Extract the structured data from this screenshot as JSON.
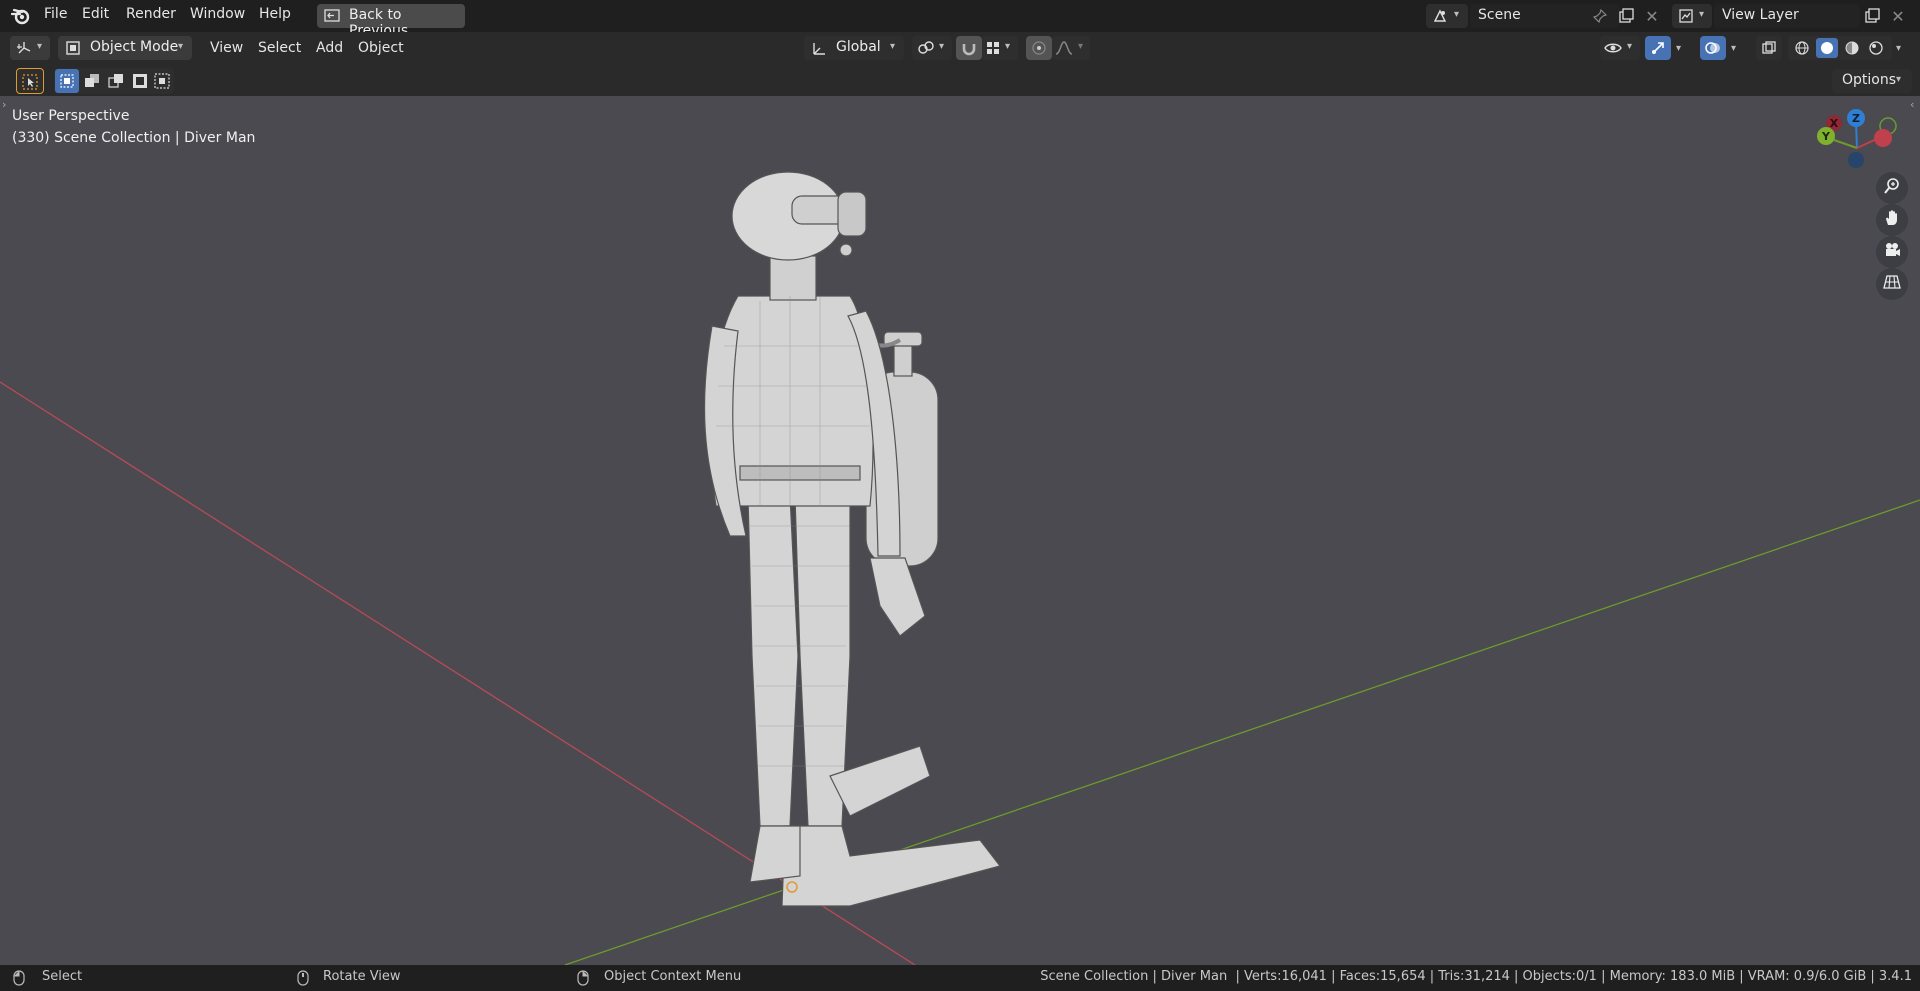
{
  "topbar": {
    "menus": [
      "File",
      "Edit",
      "Render",
      "Window",
      "Help"
    ],
    "back_button": "Back to Previous",
    "scene_name": "Scene",
    "view_layer_name": "View Layer"
  },
  "header": {
    "mode": "Object Mode",
    "menus": [
      "View",
      "Select",
      "Add",
      "Object"
    ],
    "transform_orientation": "Global"
  },
  "toolbar": {
    "options_label": "Options"
  },
  "viewport": {
    "perspective_label": "User Perspective",
    "collection_label": "(330) Scene Collection | Diver Man",
    "gizmo": {
      "x": "X",
      "y": "Y",
      "z": "Z"
    }
  },
  "status": {
    "select": "Select",
    "rotate": "Rotate View",
    "context_menu": "Object Context Menu",
    "stats": "Scene Collection | Diver Man  | Verts:16,041 | Faces:15,654 | Tris:31,214 | Objects:0/1 | Memory: 183.0 MiB | VRAM: 0.9/6.0 GiB | 3.4.1"
  },
  "colors": {
    "accent": "#4772b3",
    "x_axis": "#c0404c",
    "y_axis": "#6e9a2c",
    "z_axis": "#2f7fd6",
    "viewport_bg": "#4a4a50"
  }
}
